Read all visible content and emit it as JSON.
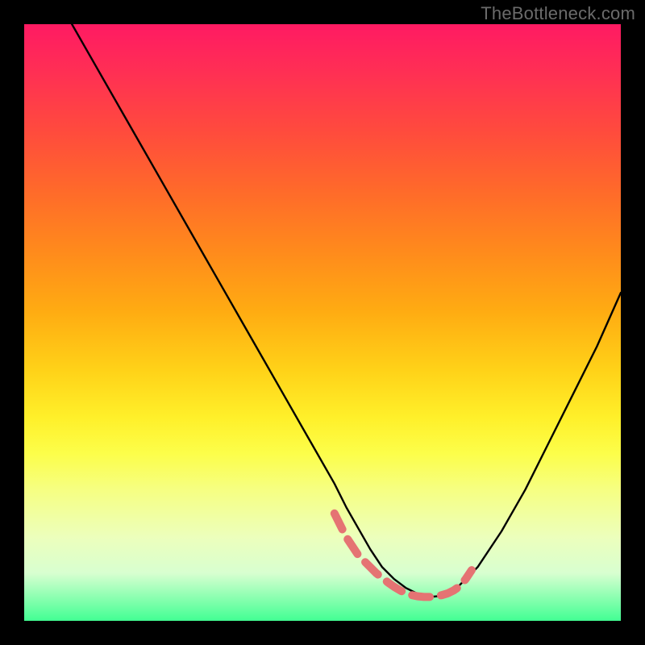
{
  "watermark": {
    "text": "TheBottleneck.com"
  },
  "chart_data": {
    "type": "line",
    "title": "",
    "xlabel": "",
    "ylabel": "",
    "xlim": [
      0,
      100
    ],
    "ylim": [
      0,
      100
    ],
    "series": [
      {
        "name": "bottleneck-curve",
        "x": [
          8,
          12,
          16,
          20,
          24,
          28,
          32,
          36,
          40,
          44,
          48,
          52,
          54,
          56,
          58,
          60,
          62,
          64,
          66,
          68,
          70,
          72,
          76,
          80,
          84,
          88,
          92,
          96,
          100
        ],
        "y": [
          100,
          93,
          86,
          79,
          72,
          65,
          58,
          51,
          44,
          37,
          30,
          23,
          19,
          15.5,
          12,
          9,
          7,
          5.5,
          4.5,
          4,
          4.2,
          5,
          9,
          15,
          22,
          30,
          38,
          46,
          55
        ],
        "stroke": "#000000",
        "stroke_width": 2.4
      },
      {
        "name": "valley-marker",
        "x": [
          52,
          53,
          54,
          55,
          56,
          57,
          58,
          59,
          60,
          61,
          62,
          63,
          64,
          65,
          66,
          67,
          68,
          69,
          70,
          71,
          72,
          73,
          74,
          75
        ],
        "y": [
          18,
          16,
          14,
          12.5,
          11,
          10,
          9,
          8,
          7.2,
          6.4,
          5.7,
          5.1,
          4.6,
          4.3,
          4.1,
          4.0,
          4.0,
          4.1,
          4.3,
          4.6,
          5.1,
          5.8,
          7.0,
          8.5
        ],
        "stroke": "#e57373",
        "stroke_width": 10,
        "dasharray": "22 14"
      }
    ],
    "background_gradient": {
      "top": "#ff1a63",
      "middle": "#ffd218",
      "bottom": "#42ff93"
    }
  }
}
